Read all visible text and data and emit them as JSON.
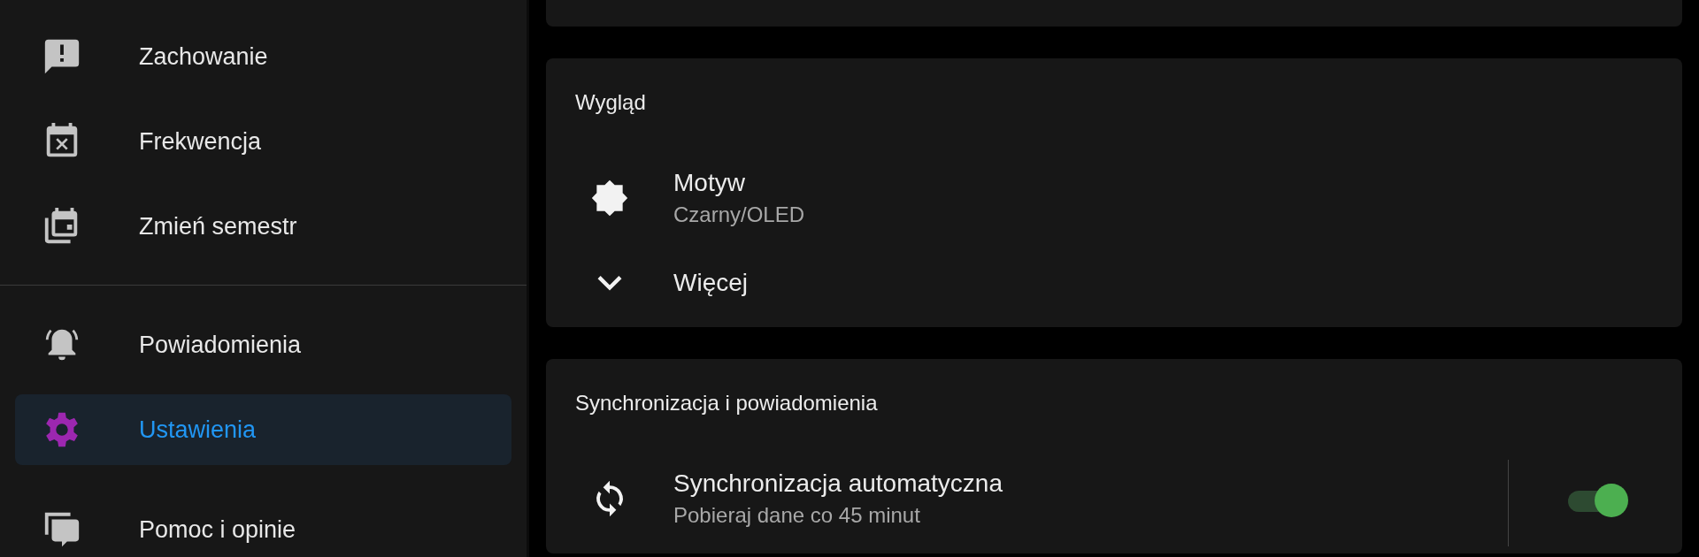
{
  "sidebar": {
    "sections": [
      {
        "items": [
          {
            "label": "Zachowanie",
            "selected": false
          },
          {
            "label": "Frekwencja",
            "selected": false
          },
          {
            "label": "Zmień semestr",
            "selected": false
          }
        ]
      },
      {
        "items": [
          {
            "label": "Powiadomienia",
            "selected": false
          },
          {
            "label": "Ustawienia",
            "selected": true
          },
          {
            "label": "Pomoc i opinie",
            "selected": false
          }
        ]
      }
    ]
  },
  "cards": [
    {
      "title": "Wygląd",
      "rows": [
        {
          "kind": "option",
          "title": "Motyw",
          "subtitle": "Czarny/OLED"
        },
        {
          "kind": "expand",
          "title": "Więcej"
        }
      ]
    },
    {
      "title": "Synchronizacja i powiadomienia",
      "rows": [
        {
          "kind": "toggle",
          "title": "Synchronizacja automatyczna",
          "subtitle": "Pobieraj dane co 45 minut",
          "on": true
        }
      ]
    }
  ]
}
